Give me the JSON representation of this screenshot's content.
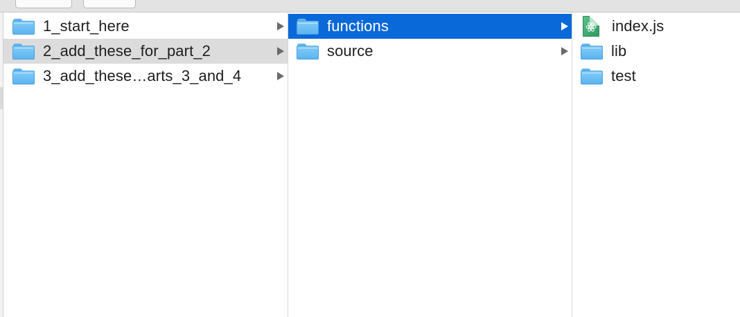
{
  "columns": [
    {
      "items": [
        {
          "label": "1_start_here",
          "icon": "folder-icon",
          "has_children": true,
          "selection": "none"
        },
        {
          "label": "2_add_these_for_part_2",
          "icon": "folder-icon",
          "has_children": true,
          "selection": "inactive"
        },
        {
          "label": "3_add_these…arts_3_and_4",
          "icon": "folder-icon",
          "has_children": true,
          "selection": "none"
        }
      ]
    },
    {
      "items": [
        {
          "label": "functions",
          "icon": "folder-icon",
          "has_children": true,
          "selection": "active"
        },
        {
          "label": "source",
          "icon": "folder-icon",
          "has_children": true,
          "selection": "none"
        }
      ]
    },
    {
      "items": [
        {
          "label": "index.js",
          "icon": "js-file-icon",
          "has_children": false,
          "selection": "none"
        },
        {
          "label": "lib",
          "icon": "folder-icon",
          "has_children": false,
          "selection": "none"
        },
        {
          "label": "test",
          "icon": "folder-icon",
          "has_children": false,
          "selection": "none"
        }
      ]
    }
  ],
  "colors": {
    "active_selection": "#0a69d9",
    "inactive_selection": "#dcdcdc",
    "folder": "#6bbcf2",
    "js_file": "#3aa870"
  }
}
